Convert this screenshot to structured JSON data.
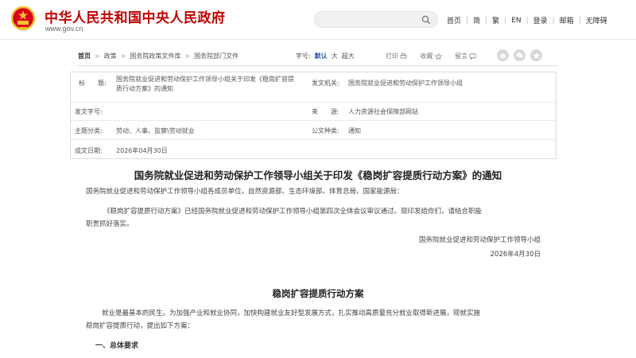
{
  "header": {
    "site_title": "中华人民共和国中央人民政府",
    "site_url": "www.gov.cn",
    "search_placeholder": "",
    "nav": [
      "首页",
      "简",
      "繁",
      "EN",
      "登录",
      "邮箱",
      "无障碍"
    ],
    "brand_color": "#c00000"
  },
  "breadcrumb": {
    "items": [
      "首页",
      "政策",
      "国务院政策文件库",
      "国务院部门文件"
    ],
    "fontsize_label": "字号:",
    "fontsize_options": [
      "默认",
      "大",
      "超大"
    ],
    "tools": [
      "打印",
      "收藏",
      "留言"
    ],
    "share_icons": [
      "weibo-icon",
      "wechat-icon",
      "qzone-icon"
    ]
  },
  "info": {
    "title_label": "标　　题:",
    "title_value_line1": "国务院就业促进和劳动保护工作领导小组关于印发《稳岗扩容提",
    "title_value_line2": "质行动方案》的通知",
    "issuer_label": "发文机关:",
    "issuer_value": "国务院就业促进和劳动保护工作领导小组",
    "docno_label": "发文字号:",
    "docno_value": "",
    "source_label": "来　　源:",
    "source_value": "人力资源社会保障部网站",
    "topic_label": "主题分类:",
    "topic_value": "劳动、人事、监察\\劳动就业",
    "type_label": "公文种类:",
    "type_value": "通知",
    "date_label": "成文日期:",
    "date_value": "2026年04月30日"
  },
  "document": {
    "title": "国务院就业促进和劳动保护工作领导小组关于印发《稳岗扩容提质行动方案》的通知",
    "recipients": "国务院就业促进和劳动保护工作领导小组各成员单位，自然资源部、生态环境部、体育总局、国家能源局：",
    "body_line1": "《稳岗扩容提质行动方案》已经国务院就业促进和劳动保护工作领导小组第四次全体会议审议通过。现印发给你们，请结合职能",
    "body_line2": "职责抓好落实。",
    "signer": "国务院就业促进和劳动保护工作领导小组",
    "sign_date": "2026年4月30日",
    "plan_title": "稳岗扩容提质行动方案",
    "plan_p1_line1": "就业是最基本的民生。为加强产业和就业协同，加快构建就业友好型发展方式，扎实推动高质量充分就业取得新进展，现就实施",
    "plan_p1_line2": "稳岗扩容提质行动，提出如下方案：",
    "section1": "一、总体要求"
  }
}
